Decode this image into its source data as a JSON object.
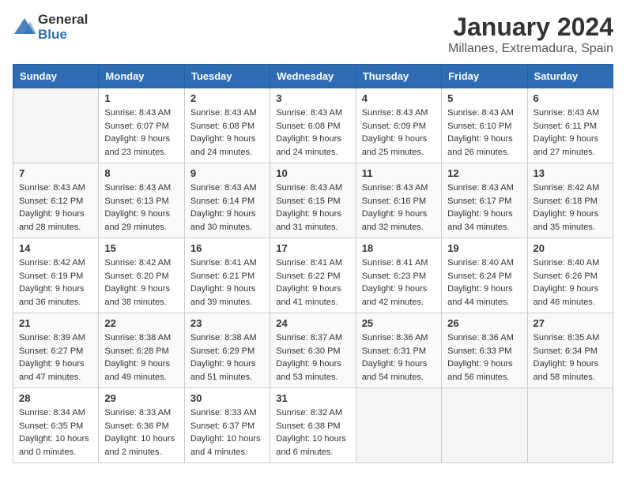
{
  "header": {
    "logo_general": "General",
    "logo_blue": "Blue",
    "month": "January 2024",
    "location": "Millanes, Extremadura, Spain"
  },
  "weekdays": [
    "Sunday",
    "Monday",
    "Tuesday",
    "Wednesday",
    "Thursday",
    "Friday",
    "Saturday"
  ],
  "weeks": [
    [
      {
        "day": "",
        "sunrise": "",
        "sunset": "",
        "daylight": ""
      },
      {
        "day": "1",
        "sunrise": "Sunrise: 8:43 AM",
        "sunset": "Sunset: 6:07 PM",
        "daylight": "Daylight: 9 hours and 23 minutes."
      },
      {
        "day": "2",
        "sunrise": "Sunrise: 8:43 AM",
        "sunset": "Sunset: 6:08 PM",
        "daylight": "Daylight: 9 hours and 24 minutes."
      },
      {
        "day": "3",
        "sunrise": "Sunrise: 8:43 AM",
        "sunset": "Sunset: 6:08 PM",
        "daylight": "Daylight: 9 hours and 24 minutes."
      },
      {
        "day": "4",
        "sunrise": "Sunrise: 8:43 AM",
        "sunset": "Sunset: 6:09 PM",
        "daylight": "Daylight: 9 hours and 25 minutes."
      },
      {
        "day": "5",
        "sunrise": "Sunrise: 8:43 AM",
        "sunset": "Sunset: 6:10 PM",
        "daylight": "Daylight: 9 hours and 26 minutes."
      },
      {
        "day": "6",
        "sunrise": "Sunrise: 8:43 AM",
        "sunset": "Sunset: 6:11 PM",
        "daylight": "Daylight: 9 hours and 27 minutes."
      }
    ],
    [
      {
        "day": "7",
        "sunrise": "Sunrise: 8:43 AM",
        "sunset": "Sunset: 6:12 PM",
        "daylight": "Daylight: 9 hours and 28 minutes."
      },
      {
        "day": "8",
        "sunrise": "Sunrise: 8:43 AM",
        "sunset": "Sunset: 6:13 PM",
        "daylight": "Daylight: 9 hours and 29 minutes."
      },
      {
        "day": "9",
        "sunrise": "Sunrise: 8:43 AM",
        "sunset": "Sunset: 6:14 PM",
        "daylight": "Daylight: 9 hours and 30 minutes."
      },
      {
        "day": "10",
        "sunrise": "Sunrise: 8:43 AM",
        "sunset": "Sunset: 6:15 PM",
        "daylight": "Daylight: 9 hours and 31 minutes."
      },
      {
        "day": "11",
        "sunrise": "Sunrise: 8:43 AM",
        "sunset": "Sunset: 6:16 PM",
        "daylight": "Daylight: 9 hours and 32 minutes."
      },
      {
        "day": "12",
        "sunrise": "Sunrise: 8:43 AM",
        "sunset": "Sunset: 6:17 PM",
        "daylight": "Daylight: 9 hours and 34 minutes."
      },
      {
        "day": "13",
        "sunrise": "Sunrise: 8:42 AM",
        "sunset": "Sunset: 6:18 PM",
        "daylight": "Daylight: 9 hours and 35 minutes."
      }
    ],
    [
      {
        "day": "14",
        "sunrise": "Sunrise: 8:42 AM",
        "sunset": "Sunset: 6:19 PM",
        "daylight": "Daylight: 9 hours and 36 minutes."
      },
      {
        "day": "15",
        "sunrise": "Sunrise: 8:42 AM",
        "sunset": "Sunset: 6:20 PM",
        "daylight": "Daylight: 9 hours and 38 minutes."
      },
      {
        "day": "16",
        "sunrise": "Sunrise: 8:41 AM",
        "sunset": "Sunset: 6:21 PM",
        "daylight": "Daylight: 9 hours and 39 minutes."
      },
      {
        "day": "17",
        "sunrise": "Sunrise: 8:41 AM",
        "sunset": "Sunset: 6:22 PM",
        "daylight": "Daylight: 9 hours and 41 minutes."
      },
      {
        "day": "18",
        "sunrise": "Sunrise: 8:41 AM",
        "sunset": "Sunset: 6:23 PM",
        "daylight": "Daylight: 9 hours and 42 minutes."
      },
      {
        "day": "19",
        "sunrise": "Sunrise: 8:40 AM",
        "sunset": "Sunset: 6:24 PM",
        "daylight": "Daylight: 9 hours and 44 minutes."
      },
      {
        "day": "20",
        "sunrise": "Sunrise: 8:40 AM",
        "sunset": "Sunset: 6:26 PM",
        "daylight": "Daylight: 9 hours and 46 minutes."
      }
    ],
    [
      {
        "day": "21",
        "sunrise": "Sunrise: 8:39 AM",
        "sunset": "Sunset: 6:27 PM",
        "daylight": "Daylight: 9 hours and 47 minutes."
      },
      {
        "day": "22",
        "sunrise": "Sunrise: 8:38 AM",
        "sunset": "Sunset: 6:28 PM",
        "daylight": "Daylight: 9 hours and 49 minutes."
      },
      {
        "day": "23",
        "sunrise": "Sunrise: 8:38 AM",
        "sunset": "Sunset: 6:29 PM",
        "daylight": "Daylight: 9 hours and 51 minutes."
      },
      {
        "day": "24",
        "sunrise": "Sunrise: 8:37 AM",
        "sunset": "Sunset: 6:30 PM",
        "daylight": "Daylight: 9 hours and 53 minutes."
      },
      {
        "day": "25",
        "sunrise": "Sunrise: 8:36 AM",
        "sunset": "Sunset: 6:31 PM",
        "daylight": "Daylight: 9 hours and 54 minutes."
      },
      {
        "day": "26",
        "sunrise": "Sunrise: 8:36 AM",
        "sunset": "Sunset: 6:33 PM",
        "daylight": "Daylight: 9 hours and 56 minutes."
      },
      {
        "day": "27",
        "sunrise": "Sunrise: 8:35 AM",
        "sunset": "Sunset: 6:34 PM",
        "daylight": "Daylight: 9 hours and 58 minutes."
      }
    ],
    [
      {
        "day": "28",
        "sunrise": "Sunrise: 8:34 AM",
        "sunset": "Sunset: 6:35 PM",
        "daylight": "Daylight: 10 hours and 0 minutes."
      },
      {
        "day": "29",
        "sunrise": "Sunrise: 8:33 AM",
        "sunset": "Sunset: 6:36 PM",
        "daylight": "Daylight: 10 hours and 2 minutes."
      },
      {
        "day": "30",
        "sunrise": "Sunrise: 8:33 AM",
        "sunset": "Sunset: 6:37 PM",
        "daylight": "Daylight: 10 hours and 4 minutes."
      },
      {
        "day": "31",
        "sunrise": "Sunrise: 8:32 AM",
        "sunset": "Sunset: 6:38 PM",
        "daylight": "Daylight: 10 hours and 6 minutes."
      },
      {
        "day": "",
        "sunrise": "",
        "sunset": "",
        "daylight": ""
      },
      {
        "day": "",
        "sunrise": "",
        "sunset": "",
        "daylight": ""
      },
      {
        "day": "",
        "sunrise": "",
        "sunset": "",
        "daylight": ""
      }
    ]
  ]
}
